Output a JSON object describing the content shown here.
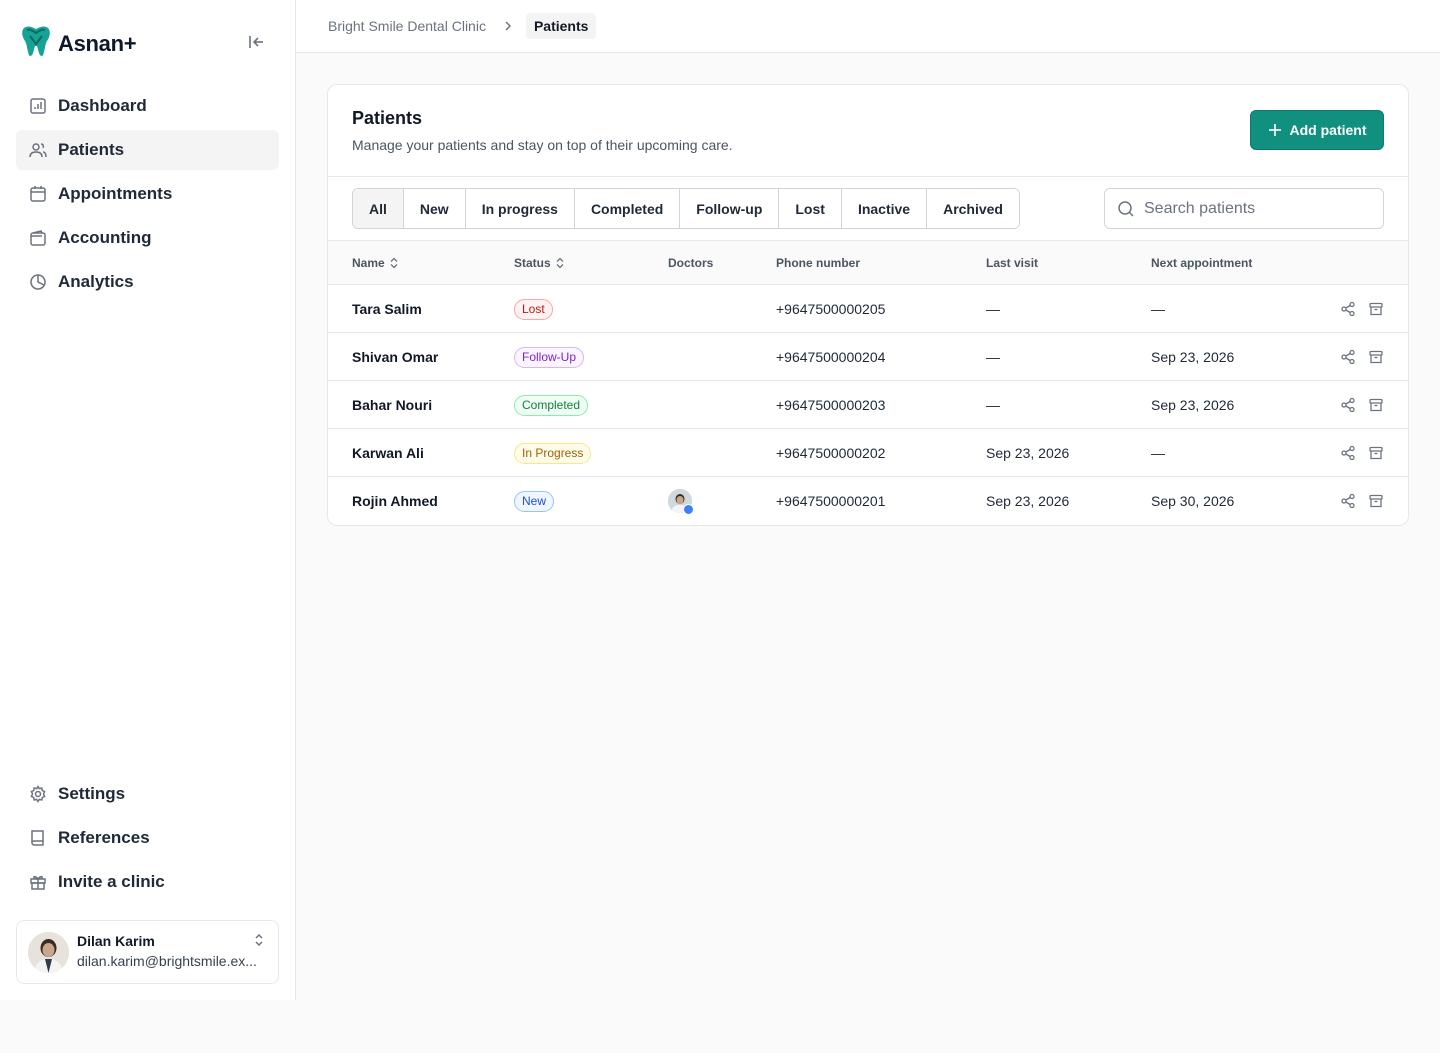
{
  "app": {
    "name": "Asnan+",
    "brand_color": "#12907f"
  },
  "sidebar": {
    "nav": [
      {
        "label": "Dashboard",
        "icon": "chart-icon"
      },
      {
        "label": "Patients",
        "icon": "users-icon",
        "active": true
      },
      {
        "label": "Appointments",
        "icon": "calendar-icon"
      },
      {
        "label": "Accounting",
        "icon": "wallet-icon"
      },
      {
        "label": "Analytics",
        "icon": "pie-chart-icon"
      }
    ],
    "bottom": [
      {
        "label": "Settings",
        "icon": "gear-icon"
      },
      {
        "label": "References",
        "icon": "book-icon"
      },
      {
        "label": "Invite a clinic",
        "icon": "gift-icon"
      }
    ],
    "user": {
      "name": "Dilan Karim",
      "email": "dilan.karim@brightsmile.ex..."
    }
  },
  "breadcrumb": {
    "clinic": "Bright Smile Dental Clinic",
    "current": "Patients"
  },
  "page": {
    "title": "Patients",
    "subtitle": "Manage your patients and stay on top of their upcoming care.",
    "add_label": "Add patient"
  },
  "tabs": [
    "All",
    "New",
    "In progress",
    "Completed",
    "Follow-up",
    "Lost",
    "Inactive",
    "Archived"
  ],
  "active_tab": "All",
  "search": {
    "placeholder": "Search patients"
  },
  "table": {
    "columns": [
      "Name",
      "Status",
      "Doctors",
      "Phone number",
      "Last visit",
      "Next appointment"
    ],
    "rows": [
      {
        "name": "Tara Salim",
        "status": "Lost",
        "status_kind": "lost",
        "doctor": false,
        "phone": "+9647500000205",
        "last_visit": "—",
        "next": "—"
      },
      {
        "name": "Shivan Omar",
        "status": "Follow-Up",
        "status_kind": "followup",
        "doctor": false,
        "phone": "+9647500000204",
        "last_visit": "—",
        "next": "Sep 23, 2026"
      },
      {
        "name": "Bahar Nouri",
        "status": "Completed",
        "status_kind": "completed",
        "doctor": false,
        "phone": "+9647500000203",
        "last_visit": "—",
        "next": "Sep 23, 2026"
      },
      {
        "name": "Karwan Ali",
        "status": "In Progress",
        "status_kind": "inprogress",
        "doctor": false,
        "phone": "+9647500000202",
        "last_visit": "Sep 23, 2026",
        "next": "—"
      },
      {
        "name": "Rojin Ahmed",
        "status": "New",
        "status_kind": "new",
        "doctor": true,
        "phone": "+9647500000201",
        "last_visit": "Sep 23, 2026",
        "next": "Sep 30, 2026"
      }
    ]
  }
}
